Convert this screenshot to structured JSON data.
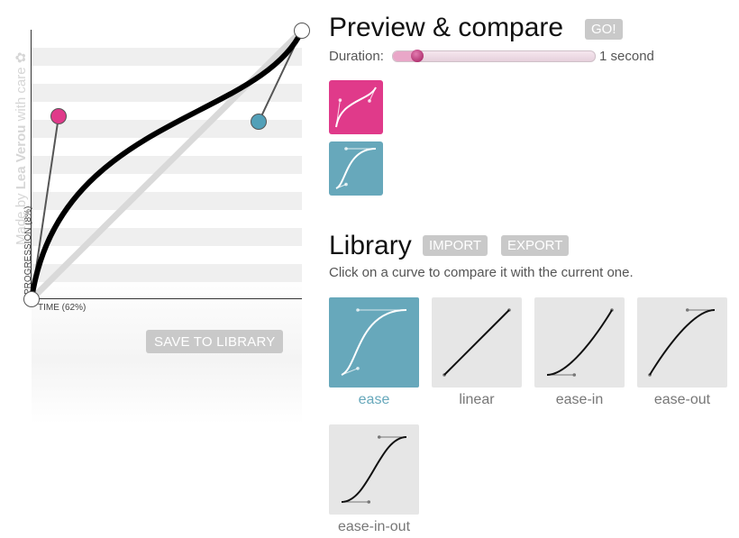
{
  "editor": {
    "progress_label": "PROGRESSION (8%)",
    "time_label": "TIME (62%)",
    "credit_prefix": "Made by ",
    "credit_author": "Lea Verou",
    "credit_suffix": " with care ✿",
    "save_label": "SAVE TO LIBRARY",
    "current_curve": [
      0.1,
      0.68,
      0.84,
      0.66
    ],
    "handle_colors": [
      "#e03a8a",
      "#53a0b8"
    ]
  },
  "preview": {
    "title": "Preview & compare",
    "go_label": "GO!",
    "duration_label": "Duration:",
    "duration_value": "1 second",
    "duration_fraction": 0.12,
    "boxes": [
      {
        "color": "#e03a8a",
        "curve": [
          0.1,
          0.68,
          0.84,
          0.66
        ]
      },
      {
        "color": "#67a8bb",
        "curve": [
          0.25,
          0.1,
          0.25,
          1
        ]
      }
    ]
  },
  "library": {
    "title": "Library",
    "import_label": "IMPORT",
    "export_label": "EXPORT",
    "hint": "Click on a curve to compare it with the current one.",
    "items": [
      {
        "name": "ease",
        "curve": [
          0.25,
          0.1,
          0.25,
          1
        ],
        "active": true
      },
      {
        "name": "linear",
        "curve": [
          0,
          0,
          1,
          1
        ],
        "active": false
      },
      {
        "name": "ease-in",
        "curve": [
          0.42,
          0,
          1,
          1
        ],
        "active": false
      },
      {
        "name": "ease-out",
        "curve": [
          0,
          0,
          0.58,
          1
        ],
        "active": false
      },
      {
        "name": "ease-in-out",
        "curve": [
          0.42,
          0,
          0.58,
          1
        ],
        "active": false
      }
    ]
  }
}
